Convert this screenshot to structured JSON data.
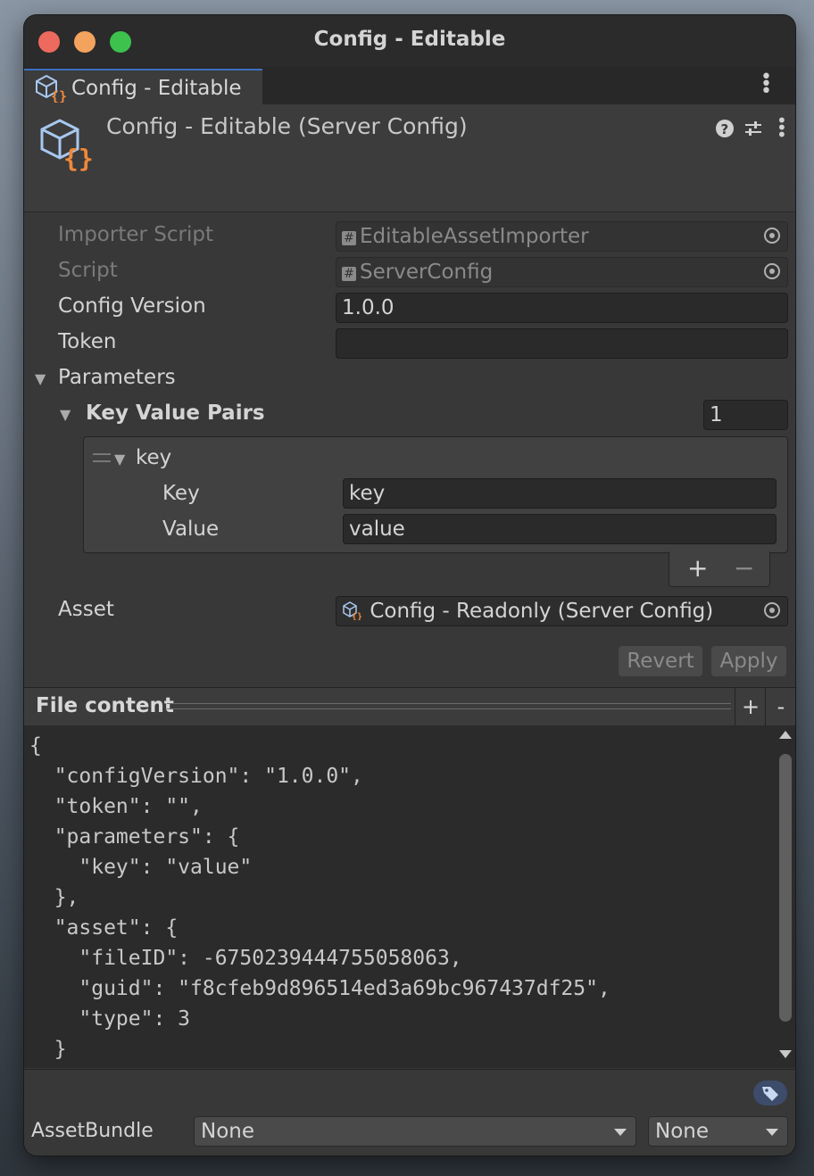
{
  "window": {
    "title": "Config - Editable"
  },
  "tab": {
    "label": "Config - Editable"
  },
  "header": {
    "title": "Config - Editable (Server Config)",
    "help_icon": "question-icon",
    "settings_icon": "preset-sliders-icon",
    "menu_icon": "kebab-menu-icon"
  },
  "fields": {
    "importer_script": {
      "label": "Importer Script",
      "value": "EditableAssetImporter"
    },
    "script": {
      "label": "Script",
      "value": "ServerConfig"
    },
    "config_version": {
      "label": "Config Version",
      "value": "1.0.0"
    },
    "token": {
      "label": "Token",
      "value": ""
    },
    "parameters": {
      "label": "Parameters"
    },
    "key_value_pairs": {
      "label": "Key Value Pairs",
      "count": "1"
    },
    "element": {
      "label": "key",
      "key_label": "Key",
      "key_value": "key",
      "value_label": "Value",
      "value_value": "value"
    },
    "asset": {
      "label": "Asset",
      "value": "Config - Readonly (Server Config)"
    }
  },
  "list_controls": {
    "add": "+",
    "remove": "−"
  },
  "buttons": {
    "revert": "Revert",
    "apply": "Apply"
  },
  "file_content": {
    "label": "File content",
    "add": "+",
    "remove": "-",
    "lines": [
      "{",
      "  \"configVersion\": \"1.0.0\",",
      "  \"token\": \"\",",
      "  \"parameters\": {",
      "    \"key\": \"value\"",
      "  },",
      "  \"asset\": {",
      "    \"fileID\": -6750239444755058063,",
      "    \"guid\": \"f8cfeb9d896514ed3a69bc967437df25\",",
      "    \"type\": 3",
      "  }"
    ]
  },
  "asset_bundle": {
    "label": "AssetBundle",
    "name": "None",
    "variant": "None"
  },
  "colors": {
    "accent": "#3d6fbd",
    "icon_orange": "#f0883a",
    "icon_blue": "#a8c8f0"
  }
}
